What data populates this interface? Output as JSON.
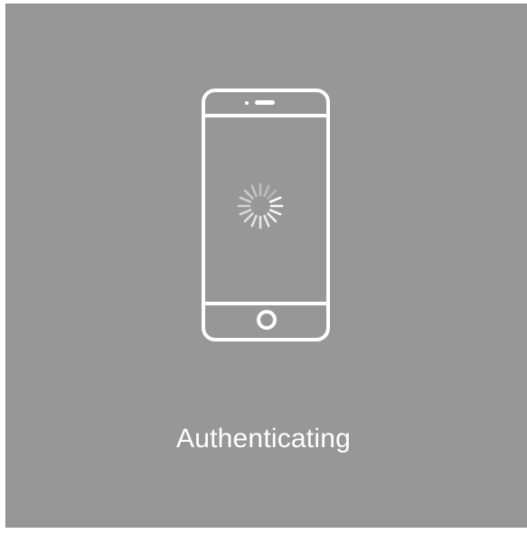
{
  "status": {
    "text": "Authenticating"
  },
  "icons": {
    "phone": "smartphone-icon",
    "spinner": "loading-spinner-icon"
  },
  "colors": {
    "panel_background": "#979797",
    "foreground": "#ffffff"
  }
}
